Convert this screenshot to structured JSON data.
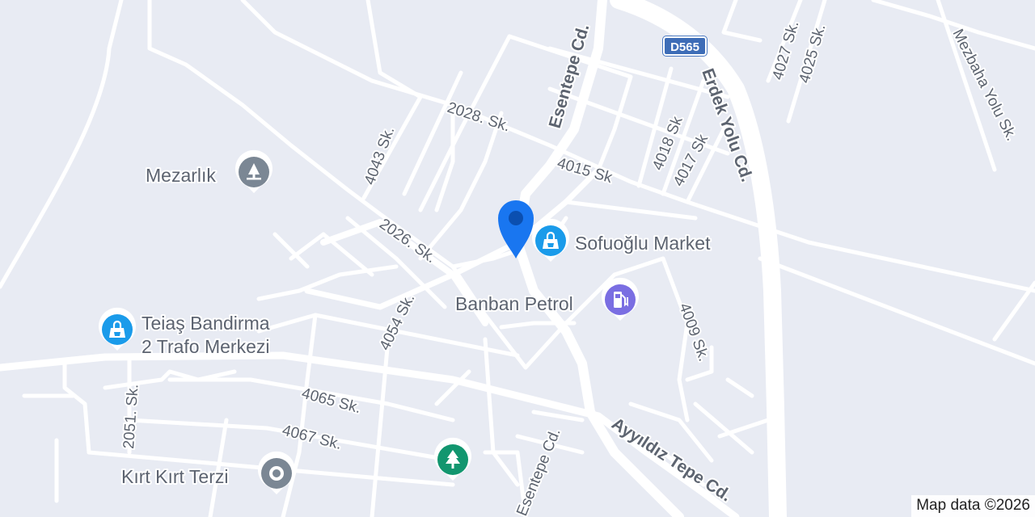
{
  "map": {
    "roads_major": [
      "Esentepe Cd.",
      "Erdek Yolu Cd.",
      "Ayyıldız Tepe Cd."
    ],
    "streets": [
      "2028. Sk.",
      "4043 Sk.",
      "2026. Sk.",
      "4054 Sk.",
      "4015 Sk",
      "4018 Sk",
      "4017 Sk",
      "4027 Sk.",
      "4025 Sk.",
      "Mezbaha Yolu Sk.",
      "4009 Sk.",
      "4065 Sk.",
      "4067 Sk.",
      "2051. Sk.",
      "Esentepe Cd."
    ],
    "shield": "D565",
    "pois": [
      {
        "name": "Mezarlık",
        "icon": "cemetery-icon",
        "color": "#7b8794"
      },
      {
        "name": "Sofuoğlu Market",
        "icon": "shopping-bag-icon",
        "color": "#1a9bea"
      },
      {
        "name": "Banban Petrol",
        "icon": "gas-station-icon",
        "color": "#7a6ee2"
      },
      {
        "name": "Teiaş Bandirma",
        "name_line2": "2 Trafo Merkezi",
        "icon": "shopping-bag-icon",
        "color": "#1a9bea"
      },
      {
        "name": "Kırt Kırt Terzi",
        "icon": "place-icon",
        "color": "#7b8794"
      },
      {
        "name": "",
        "icon": "park-tree-icon",
        "color": "#12966f"
      }
    ],
    "location_pin": {
      "icon": "location-pin-icon",
      "color": "#1976f0"
    },
    "attribution": "Map data ©2026",
    "colors": {
      "background": "#e8ebf3",
      "road": "#ffffff"
    }
  }
}
